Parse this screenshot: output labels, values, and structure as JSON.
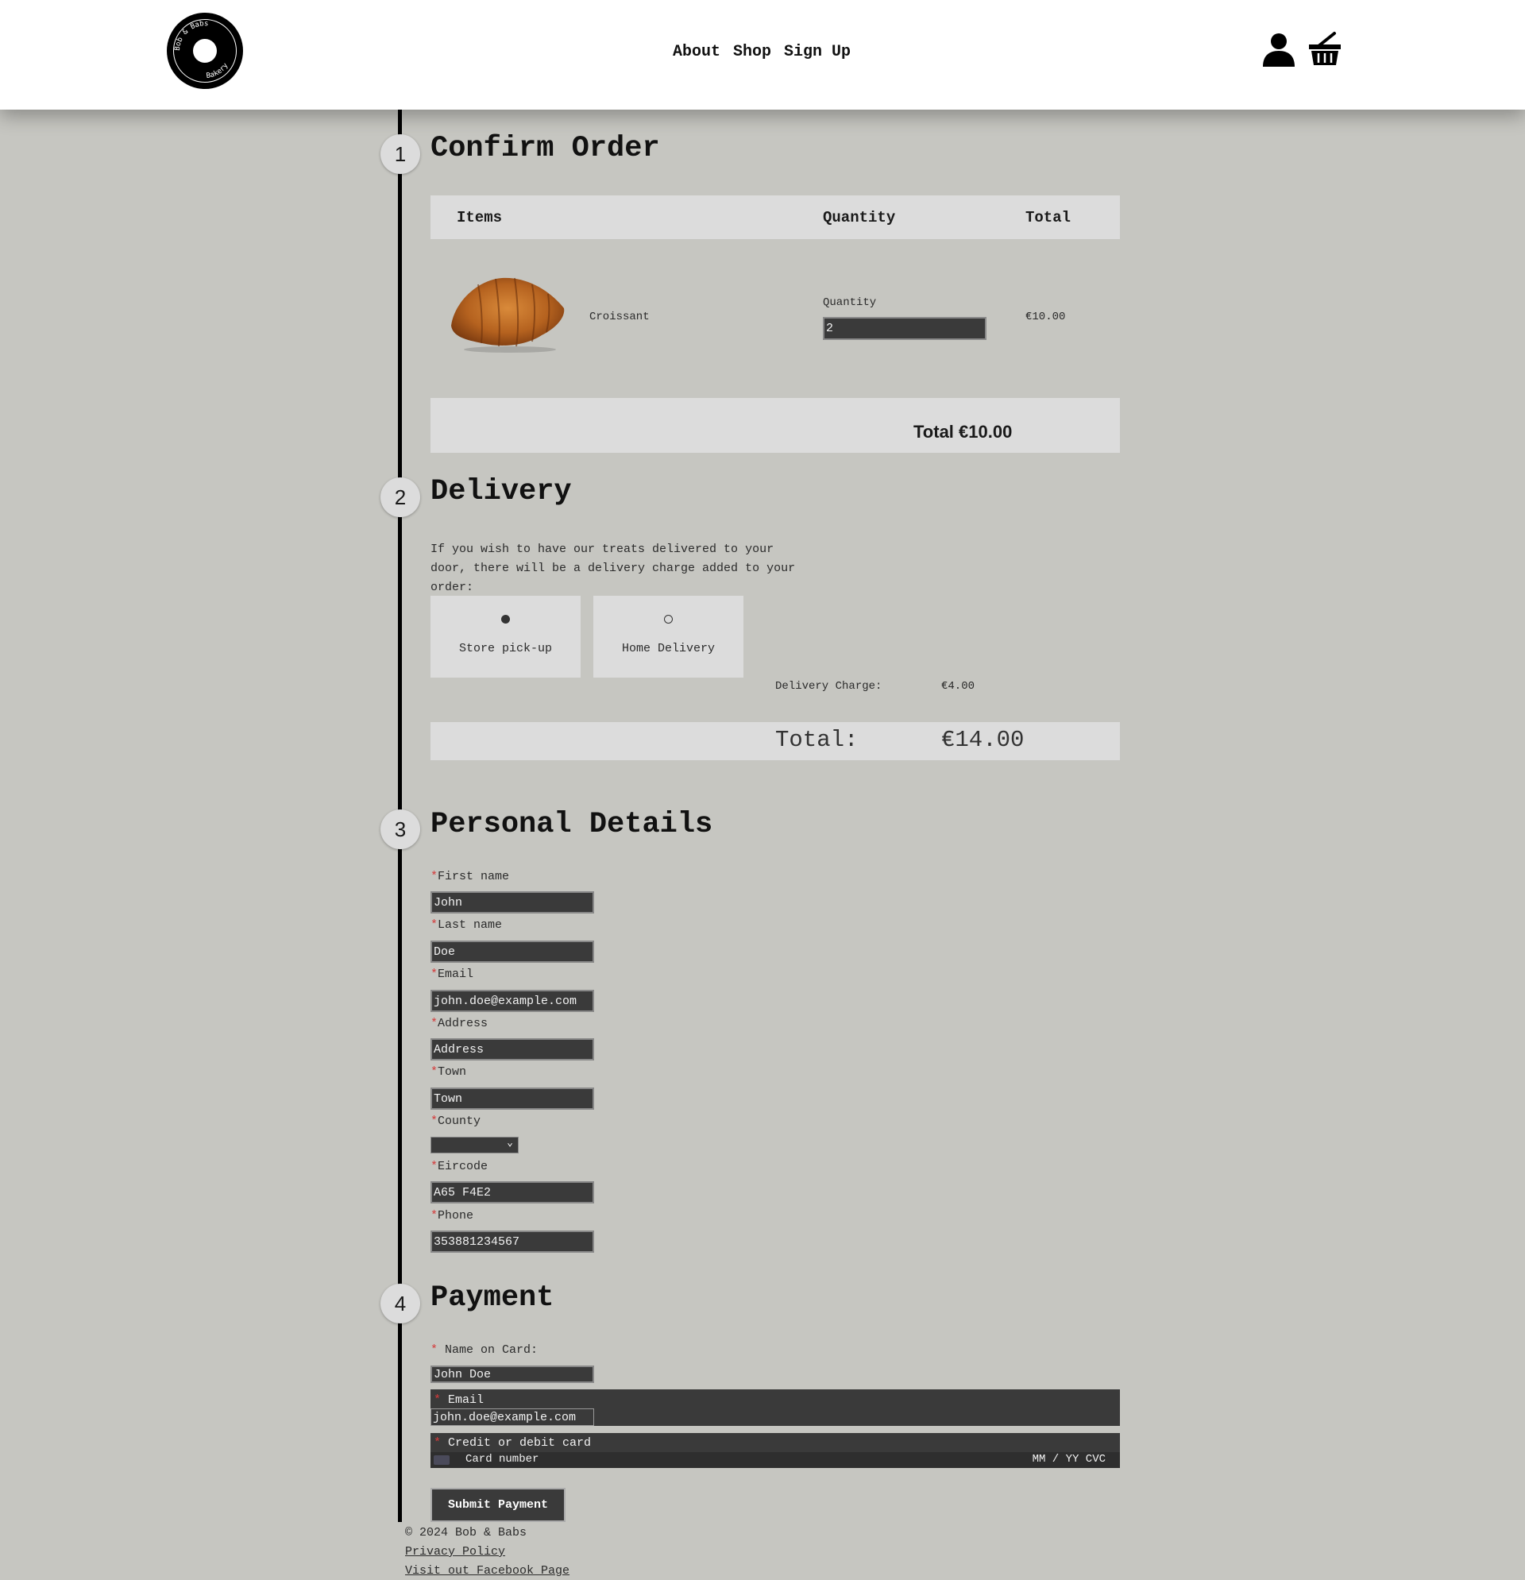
{
  "header": {
    "brand_top": "Bob & Babs",
    "brand_bottom": "Bakery",
    "nav": {
      "about": "About",
      "shop": "Shop",
      "signup": "Sign Up"
    }
  },
  "steps": {
    "one": "1",
    "two": "2",
    "three": "3",
    "four": "4"
  },
  "confirm": {
    "title": "Confirm Order",
    "col_items": "Items",
    "col_quantity": "Quantity",
    "col_total": "Total",
    "item_name": "Croissant",
    "qty_label": "Quantity",
    "qty_value": "2",
    "item_total": "€10.00",
    "total_line": "Total €10.00"
  },
  "delivery": {
    "title": "Delivery",
    "description": "If you wish to have our treats delivered to your door, there will be a delivery charge added to your order:",
    "option_pickup": "Store pick-up",
    "option_home": "Home Delivery",
    "selected": "Store pick-up",
    "charge_label": "Delivery Charge:",
    "charge_value": "€4.00",
    "total_label": "Total:",
    "total_value": "€14.00"
  },
  "personal": {
    "title": "Personal Details",
    "required_mark": "*",
    "first_name_label": "First name",
    "first_name": "John",
    "last_name_label": "Last name",
    "last_name": "Doe",
    "email_label": "Email",
    "email": "john.doe@example.com",
    "address_label": "Address",
    "address": "Address",
    "town_label": "Town",
    "town": "Town",
    "county_label": "County",
    "county": "",
    "eircode_label": "Eircode",
    "eircode": "A65 F4E2",
    "phone_label": "Phone",
    "phone": "353881234567"
  },
  "payment": {
    "title": "Payment",
    "name_label": "* Name on Card:",
    "name_value": "John Doe",
    "email_label": "Email",
    "email_value": "john.doe@example.com",
    "card_label": "Credit or debit card",
    "card_number_placeholder": "Card number",
    "card_expiry_cvc_placeholder": "MM / YY CVC",
    "submit": "Submit Payment"
  },
  "footer": {
    "copyright": "© 2024 Bob & Babs",
    "privacy": "Privacy Policy",
    "facebook": "Visit out Facebook Page"
  },
  "colors": {
    "background": "#c6c6c1",
    "panel": "#dcdcdc",
    "input_dark": "#3a3a3a",
    "required": "#d43b3b"
  },
  "icons": [
    "user-icon",
    "basket-icon",
    "logo-icon"
  ]
}
